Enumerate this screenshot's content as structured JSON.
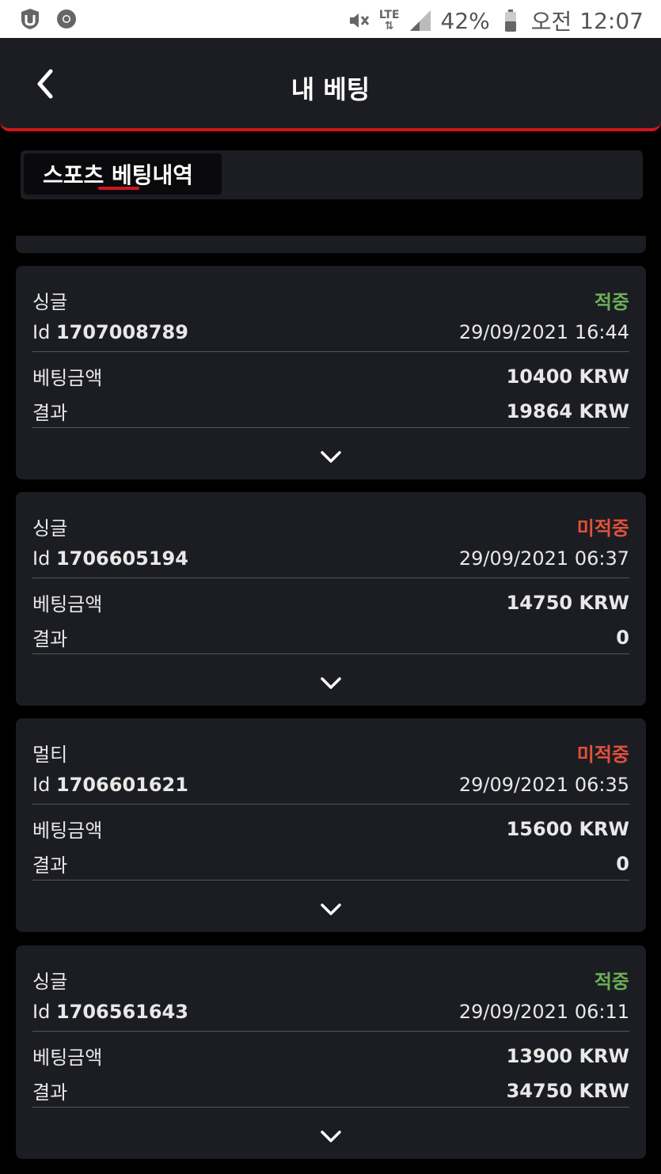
{
  "status_bar": {
    "battery": "42%",
    "ampm": "오전",
    "time": "12:07",
    "network": "LTE"
  },
  "header": {
    "title": "내 베팅"
  },
  "tabs": [
    {
      "label": "스포츠 베팅내역"
    }
  ],
  "labels": {
    "id_prefix": "Id",
    "bet_amount": "베팅금액",
    "result": "결과"
  },
  "bets": [
    {
      "type": "싱글",
      "status": "적중",
      "status_kind": "win",
      "id": "1707008789",
      "datetime": "29/09/2021 16:44",
      "amount": "10400 KRW",
      "result": "19864 KRW"
    },
    {
      "type": "싱글",
      "status": "미적중",
      "status_kind": "lose",
      "id": "1706605194",
      "datetime": "29/09/2021 06:37",
      "amount": "14750 KRW",
      "result": "0"
    },
    {
      "type": "멀티",
      "status": "미적중",
      "status_kind": "lose",
      "id": "1706601621",
      "datetime": "29/09/2021 06:35",
      "amount": "15600 KRW",
      "result": "0"
    },
    {
      "type": "싱글",
      "status": "적중",
      "status_kind": "win",
      "id": "1706561643",
      "datetime": "29/09/2021 06:11",
      "amount": "13900 KRW",
      "result": "34750 KRW"
    }
  ],
  "colors": {
    "accent": "#d0161c",
    "win": "#6aaf57",
    "lose": "#e2513b",
    "card": "#1c1d22"
  }
}
